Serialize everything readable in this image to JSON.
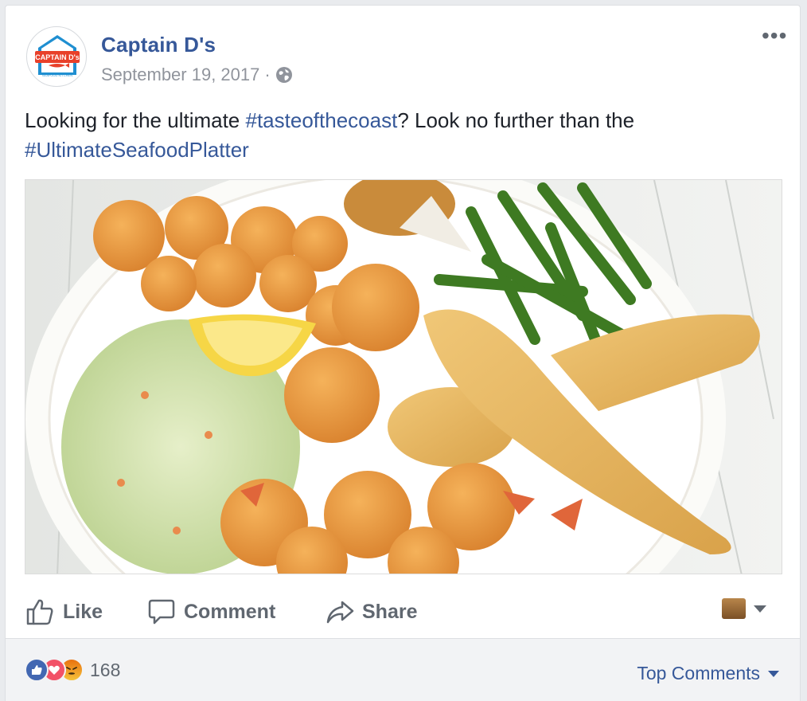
{
  "post": {
    "page_name": "Captain D's",
    "date": "September 19, 2017",
    "separator": "·",
    "text_before": "Looking for the ultimate ",
    "hashtag_1": "#tasteofthecoast",
    "text_middle": "? Look no further than the ",
    "hashtag_2": "#UltimateSeafoodPlatter",
    "more_icon": "more-options-icon",
    "privacy_icon": "globe-icon",
    "avatar_logo_text": "CAPTAIN D's",
    "avatar_logo_subtext": "SEAFOOD KITCHEN"
  },
  "actions": {
    "like": "Like",
    "comment": "Comment",
    "share": "Share"
  },
  "footer": {
    "reaction_count": "168",
    "top_comments": "Top Comments"
  },
  "colors": {
    "link_blue": "#365899",
    "action_gray": "#606770",
    "like_blue": "#4267b2",
    "love_red": "#f25268",
    "logo_red": "#e8402a",
    "logo_blue": "#1f8fd1"
  }
}
